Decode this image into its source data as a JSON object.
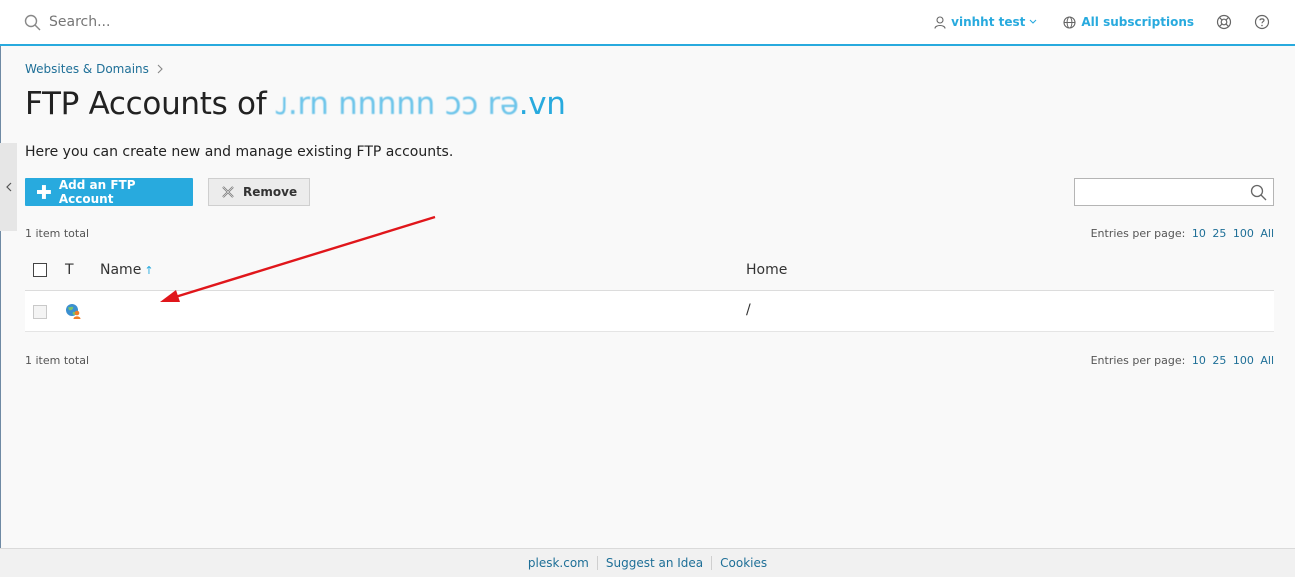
{
  "topbar": {
    "search_placeholder": "Search...",
    "user_name": "vinhht test",
    "subscriptions_label": "All subscriptions"
  },
  "breadcrumb": {
    "item": "Websites & Domains"
  },
  "page": {
    "title_prefix": "FTP Accounts of",
    "title_domain_blurred": "ᴊ.rn nnnnn ɔɔ rə",
    "title_domain_suffix": ".vn",
    "description": "Here you can create new and manage existing FTP accounts."
  },
  "toolbar": {
    "add_label": "Add an FTP Account",
    "remove_label": "Remove",
    "search_value": ""
  },
  "pagination": {
    "total_label": "1 item total",
    "entries_label": "Entries per page:",
    "options": [
      "10",
      "25",
      "100",
      "All"
    ]
  },
  "table": {
    "columns": {
      "type": "T",
      "name": "Name",
      "home": "Home"
    },
    "rows": [
      {
        "name": "",
        "home": "/"
      }
    ]
  },
  "footer": {
    "links": [
      "plesk.com",
      "Suggest an Idea",
      "Cookies"
    ]
  },
  "colors": {
    "accent": "#28aade",
    "link_dark": "#1e6f97",
    "arrow": "#e0161b"
  },
  "icons": [
    "search-icon",
    "user-icon",
    "chevron-down-icon",
    "globe-icon",
    "lifebuoy-icon",
    "help-icon",
    "chevron-left-icon",
    "chevron-right-icon",
    "plus-icon",
    "remove-x-icon",
    "ftp-account-icon"
  ]
}
